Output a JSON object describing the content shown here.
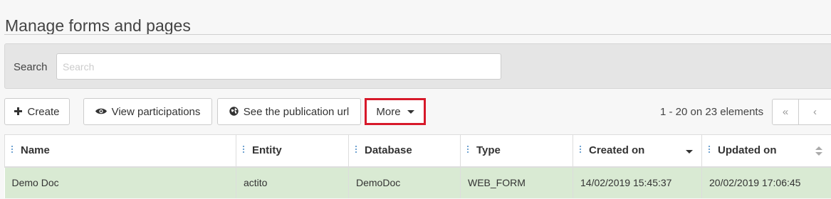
{
  "page": {
    "title": "Manage forms and pages"
  },
  "search": {
    "label": "Search",
    "placeholder": "Search",
    "value": ""
  },
  "toolbar": {
    "create_label": "Create",
    "view_participations_label": "View participations",
    "publication_url_label": "See the publication url",
    "more_label": "More",
    "highlight_color": "#d7192a"
  },
  "pager": {
    "info": "1 - 20 on 23 elements",
    "first_label": "«",
    "prev_label": "‹"
  },
  "table": {
    "columns": [
      "Name",
      "Entity",
      "Database",
      "Type",
      "Created on",
      "Updated on"
    ],
    "rows": [
      {
        "name": "Demo Doc",
        "entity": "actito",
        "database": "DemoDoc",
        "type": "WEB_FORM",
        "created_on": "14/02/2019 15:45:37",
        "updated_on": "20/02/2019 17:06:45"
      }
    ],
    "selected_row_color": "#d9ead3"
  }
}
